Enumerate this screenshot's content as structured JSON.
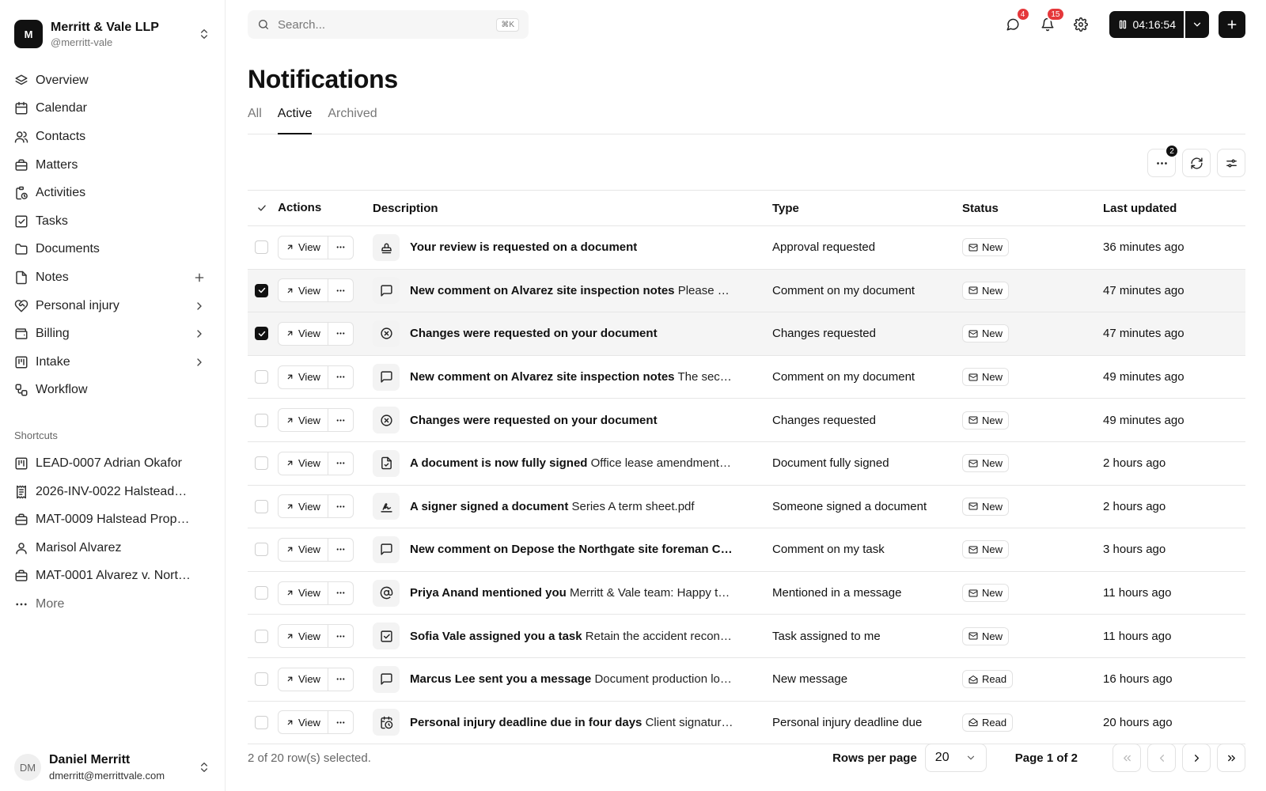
{
  "org": {
    "initial": "M",
    "name": "Merritt & Vale LLP",
    "handle": "@merritt-vale"
  },
  "nav": [
    {
      "label": "Overview",
      "icon": "layers-icon",
      "trail": ""
    },
    {
      "label": "Calendar",
      "icon": "calendar-icon",
      "trail": ""
    },
    {
      "label": "Contacts",
      "icon": "users-icon",
      "trail": ""
    },
    {
      "label": "Matters",
      "icon": "briefcase-icon",
      "trail": ""
    },
    {
      "label": "Activities",
      "icon": "clipboard-clock-icon",
      "trail": ""
    },
    {
      "label": "Tasks",
      "icon": "checkbox-icon",
      "trail": ""
    },
    {
      "label": "Documents",
      "icon": "folder-icon",
      "trail": ""
    },
    {
      "label": "Notes",
      "icon": "file-icon",
      "trail": "plus"
    },
    {
      "label": "Personal injury",
      "icon": "heart-handshake-icon",
      "trail": "chevron"
    },
    {
      "label": "Billing",
      "icon": "wallet-icon",
      "trail": "chevron"
    },
    {
      "label": "Intake",
      "icon": "kanban-icon",
      "trail": "chevron"
    },
    {
      "label": "Workflow",
      "icon": "workflow-icon",
      "trail": ""
    }
  ],
  "shortcuts_title": "Shortcuts",
  "shortcuts": [
    {
      "label": "LEAD-0007 Adrian Okafor",
      "icon": "kanban-icon"
    },
    {
      "label": "2026-INV-0022 Halstead…",
      "icon": "receipt-icon"
    },
    {
      "label": "MAT-0009 Halstead Prop…",
      "icon": "briefcase-icon"
    },
    {
      "label": "Marisol Alvarez",
      "icon": "user-icon"
    },
    {
      "label": "MAT-0001 Alvarez v. Nort…",
      "icon": "briefcase-icon"
    }
  ],
  "more_label": "More",
  "user": {
    "initials": "DM",
    "name": "Daniel Merritt",
    "email": "dmerritt@merrittvale.com"
  },
  "search": {
    "placeholder": "Search...",
    "shortcut": "⌘K"
  },
  "topbar": {
    "messages_count": "4",
    "notifications_count": "15",
    "timer": "04:16:54"
  },
  "page_title": "Notifications",
  "tabs": [
    {
      "label": "All",
      "active": false
    },
    {
      "label": "Active",
      "active": true
    },
    {
      "label": "Archived",
      "active": false
    }
  ],
  "toolbar": {
    "more_badge": "2"
  },
  "table": {
    "headers": {
      "actions": "Actions",
      "description": "Description",
      "type": "Type",
      "status": "Status",
      "updated": "Last updated"
    },
    "view_label": "View",
    "rows": [
      {
        "selected": false,
        "icon": "stamp-icon",
        "title": "Your review is requested on a document",
        "detail": "",
        "type": "Approval requested",
        "status": "New",
        "status_icon": "mail-icon",
        "updated": "36 minutes ago"
      },
      {
        "selected": true,
        "icon": "message-square-icon",
        "title": "New comment on Alvarez site inspection notes",
        "detail": "Please n…",
        "type": "Comment on my document",
        "status": "New",
        "status_icon": "mail-icon",
        "updated": "47 minutes ago"
      },
      {
        "selected": true,
        "icon": "circle-x-icon",
        "title": "Changes were requested on your document",
        "detail": "",
        "type": "Changes requested",
        "status": "New",
        "status_icon": "mail-icon",
        "updated": "47 minutes ago"
      },
      {
        "selected": false,
        "icon": "message-square-icon",
        "title": "New comment on Alvarez site inspection notes",
        "detail": "The seco…",
        "type": "Comment on my document",
        "status": "New",
        "status_icon": "mail-icon",
        "updated": "49 minutes ago"
      },
      {
        "selected": false,
        "icon": "circle-x-icon",
        "title": "Changes were requested on your document",
        "detail": "",
        "type": "Changes requested",
        "status": "New",
        "status_icon": "mail-icon",
        "updated": "49 minutes ago"
      },
      {
        "selected": false,
        "icon": "file-check-icon",
        "title": "A document is now fully signed",
        "detail": "Office lease amendment…",
        "type": "Document fully signed",
        "status": "New",
        "status_icon": "mail-icon",
        "updated": "2 hours ago"
      },
      {
        "selected": false,
        "icon": "signature-icon",
        "title": "A signer signed a document",
        "detail": "Series A term sheet.pdf",
        "type": "Someone signed a document",
        "status": "New",
        "status_icon": "mail-icon",
        "updated": "2 hours ago"
      },
      {
        "selected": false,
        "icon": "message-square-icon",
        "title": "New comment on Depose the Northgate site foreman C…",
        "detail": "",
        "type": "Comment on my task",
        "status": "New",
        "status_icon": "mail-icon",
        "updated": "3 hours ago"
      },
      {
        "selected": false,
        "icon": "at-sign-icon",
        "title": "Priya Anand mentioned you",
        "detail": "Merritt & Vale team: Happy t…",
        "type": "Mentioned in a message",
        "status": "New",
        "status_icon": "mail-icon",
        "updated": "11 hours ago"
      },
      {
        "selected": false,
        "icon": "square-check-icon",
        "title": "Sofia Vale assigned you a task",
        "detail": "Retain the accident recon…",
        "type": "Task assigned to me",
        "status": "New",
        "status_icon": "mail-icon",
        "updated": "11 hours ago"
      },
      {
        "selected": false,
        "icon": "message-square-icon",
        "title": "Marcus Lee sent you a message",
        "detail": "Document production lo…",
        "type": "New message",
        "status": "Read",
        "status_icon": "mail-open-icon",
        "updated": "16 hours ago"
      },
      {
        "selected": false,
        "icon": "calendar-clock-icon",
        "title": "Personal injury deadline due in four days",
        "detail": "Client signatur…",
        "type": "Personal injury deadline due",
        "status": "Read",
        "status_icon": "mail-open-icon",
        "updated": "20 hours ago"
      }
    ]
  },
  "footer": {
    "selection": "2 of 20 row(s) selected.",
    "rows_per_page_label": "Rows per page",
    "rows_per_page": "20",
    "page_info": "Page 1 of 2"
  }
}
